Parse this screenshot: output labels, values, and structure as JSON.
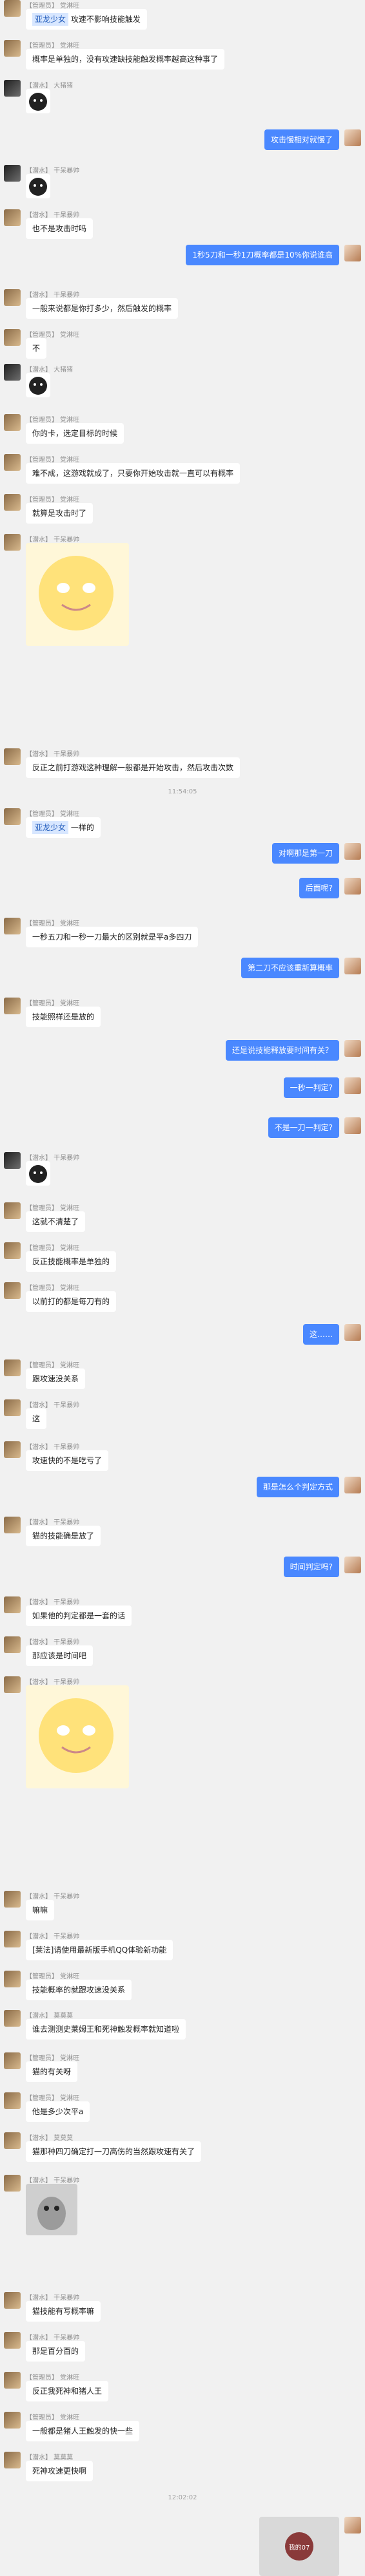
{
  "messages": [
    {
      "type": "text",
      "side": "left",
      "name": "【管理员】 党淋旺",
      "text": "",
      "quote": "亚龙少女",
      "rest": " 攻速不影响技能触发"
    },
    {
      "type": "text",
      "side": "left",
      "name": "【管理员】 党淋旺",
      "text": "概率是单独的，没有攻速缺技能触发概率越高这种事了"
    },
    {
      "type": "sticker",
      "side": "left",
      "name": "【潜水】 大猪猪",
      "kind": "small"
    },
    {
      "type": "text",
      "side": "right",
      "text": "攻击慢相对就慢了"
    },
    {
      "type": "sticker",
      "side": "left",
      "name": "【潜水】 干呆暴帅",
      "kind": "small"
    },
    {
      "type": "text",
      "side": "left",
      "name": "【潜水】 干呆暴帅",
      "text": "也不是攻击时吗"
    },
    {
      "type": "text",
      "side": "right",
      "text": "1秒5刀和一秒1刀概率都是10%你说谁高"
    },
    {
      "type": "text",
      "side": "left",
      "name": "【潜水】 干呆暴帅",
      "text": "一般来说都是你打多少，然后触发的概率"
    },
    {
      "type": "text",
      "side": "left",
      "name": "【管理员】 党淋旺",
      "text": "不"
    },
    {
      "type": "sticker",
      "side": "left",
      "name": "【潜水】 大猪猪",
      "kind": "small"
    },
    {
      "type": "text",
      "side": "left",
      "name": "【管理员】 党淋旺",
      "text": "你的卡，选定目标的时候"
    },
    {
      "type": "text",
      "side": "left",
      "name": "【管理员】 党淋旺",
      "text": "难不成，这游戏就成了，只要你开始攻击就一直可以有概率"
    },
    {
      "type": "text",
      "side": "left",
      "name": "【管理员】 党淋旺",
      "text": "就算是攻击时了"
    },
    {
      "type": "sticker",
      "side": "left",
      "name": "【潜水】 干呆暴帅",
      "kind": "big"
    },
    {
      "type": "text",
      "side": "left",
      "name": "【潜水】 干呆暴帅",
      "text": "反正之前打游戏这种理解一般都是开始攻击，然后攻击次数"
    },
    {
      "type": "time",
      "text": "11:54:05"
    },
    {
      "type": "text",
      "side": "left",
      "name": "【管理员】 党淋旺",
      "text": "",
      "quote": "亚龙少女",
      "rest": " 一样的"
    },
    {
      "type": "text",
      "side": "right",
      "text": "对啊那是第一刀"
    },
    {
      "type": "text",
      "side": "right",
      "text": "后面呢?"
    },
    {
      "type": "text",
      "side": "left",
      "name": "【管理员】 党淋旺",
      "text": "一秒五刀和一秒一刀最大的区别就是平a多四刀"
    },
    {
      "type": "text",
      "side": "right",
      "text": "第二刀不应该重新算概率"
    },
    {
      "type": "text",
      "side": "left",
      "name": "【管理员】 党淋旺",
      "text": "技能照样还是放的"
    },
    {
      "type": "text",
      "side": "right",
      "text": "还是说技能释放要时间有关？"
    },
    {
      "type": "text",
      "side": "right",
      "text": "一秒一判定?"
    },
    {
      "type": "text",
      "side": "right",
      "text": "不是一刀一判定?"
    },
    {
      "type": "sticker",
      "side": "left",
      "name": "【潜水】 干呆暴帅",
      "kind": "small"
    },
    {
      "type": "text",
      "side": "left",
      "name": "【管理员】 党淋旺",
      "text": "这就不清楚了"
    },
    {
      "type": "text",
      "side": "left",
      "name": "【管理员】 党淋旺",
      "text": "反正技能概率是单独的"
    },
    {
      "type": "text",
      "side": "left",
      "name": "【管理员】 党淋旺",
      "text": "以前打的都是每刀有的"
    },
    {
      "type": "text",
      "side": "right",
      "text": "这……"
    },
    {
      "type": "text",
      "side": "left",
      "name": "【管理员】 党淋旺",
      "text": "跟攻速没关系"
    },
    {
      "type": "text",
      "side": "left",
      "name": "【潜水】 干呆暴帅",
      "text": "这"
    },
    {
      "type": "text",
      "side": "left",
      "name": "【潜水】 干呆暴帅",
      "text": "攻速快的不是吃亏了"
    },
    {
      "type": "text",
      "side": "right",
      "text": "那是怎么个判定方式"
    },
    {
      "type": "text",
      "side": "left",
      "name": "【潜水】 干呆暴帅",
      "text": "猫的技能确是放了"
    },
    {
      "type": "text",
      "side": "right",
      "text": "时间判定吗?"
    },
    {
      "type": "text",
      "side": "left",
      "name": "【潜水】 干呆暴帅",
      "text": "如果他的判定都是一套的话"
    },
    {
      "type": "text",
      "side": "left",
      "name": "【潜水】 干呆暴帅",
      "text": "那应该是时间吧"
    },
    {
      "type": "sticker",
      "side": "left",
      "name": "【潜水】 干呆暴帅",
      "kind": "big"
    },
    {
      "type": "text",
      "side": "left",
      "name": "【潜水】 干呆暴帅",
      "text": "嘛嘛"
    },
    {
      "type": "text",
      "side": "left",
      "name": "【潜水】 干呆暴帅",
      "text": "[莱法]请使用最新版手机QQ体验新功能"
    },
    {
      "type": "text",
      "side": "left",
      "name": "【管理员】 党淋旺",
      "text": "技能概率的就跟攻速没关系"
    },
    {
      "type": "text",
      "side": "left",
      "name": "【潜水】 莫莫莫",
      "text": "谁去测测史莱姆王和死神触发概率就知道啦"
    },
    {
      "type": "text",
      "side": "left",
      "name": "【管理员】 党淋旺",
      "text": "猫的有关呀"
    },
    {
      "type": "text",
      "side": "left",
      "name": "【管理员】 党淋旺",
      "text": "他是多少次平a"
    },
    {
      "type": "text",
      "side": "left",
      "name": "【潜水】 莫莫莫",
      "text": "猫那种四刀确定打一刀高伤的当然跟攻速有关了"
    },
    {
      "type": "sticker",
      "side": "left",
      "name": "【潜水】 干呆暴帅",
      "kind": "photo"
    },
    {
      "type": "text",
      "side": "left",
      "name": "【潜水】 干呆暴帅",
      "text": "猫技能有写概率嘛"
    },
    {
      "type": "text",
      "side": "left",
      "name": "【潜水】 干呆暴帅",
      "text": "那是百分百的"
    },
    {
      "type": "text",
      "side": "left",
      "name": "【管理员】 党淋旺",
      "text": "反正我死神和猪人王"
    },
    {
      "type": "text",
      "side": "left",
      "name": "【管理员】 党淋旺",
      "text": "一般都是猪人王触发的快一些"
    },
    {
      "type": "text",
      "side": "left",
      "name": "【潜水】 莫莫莫",
      "text": "死神攻速更快啊"
    },
    {
      "type": "time",
      "text": "12:02:02"
    },
    {
      "type": "image",
      "side": "right",
      "caption": "我的07"
    }
  ]
}
